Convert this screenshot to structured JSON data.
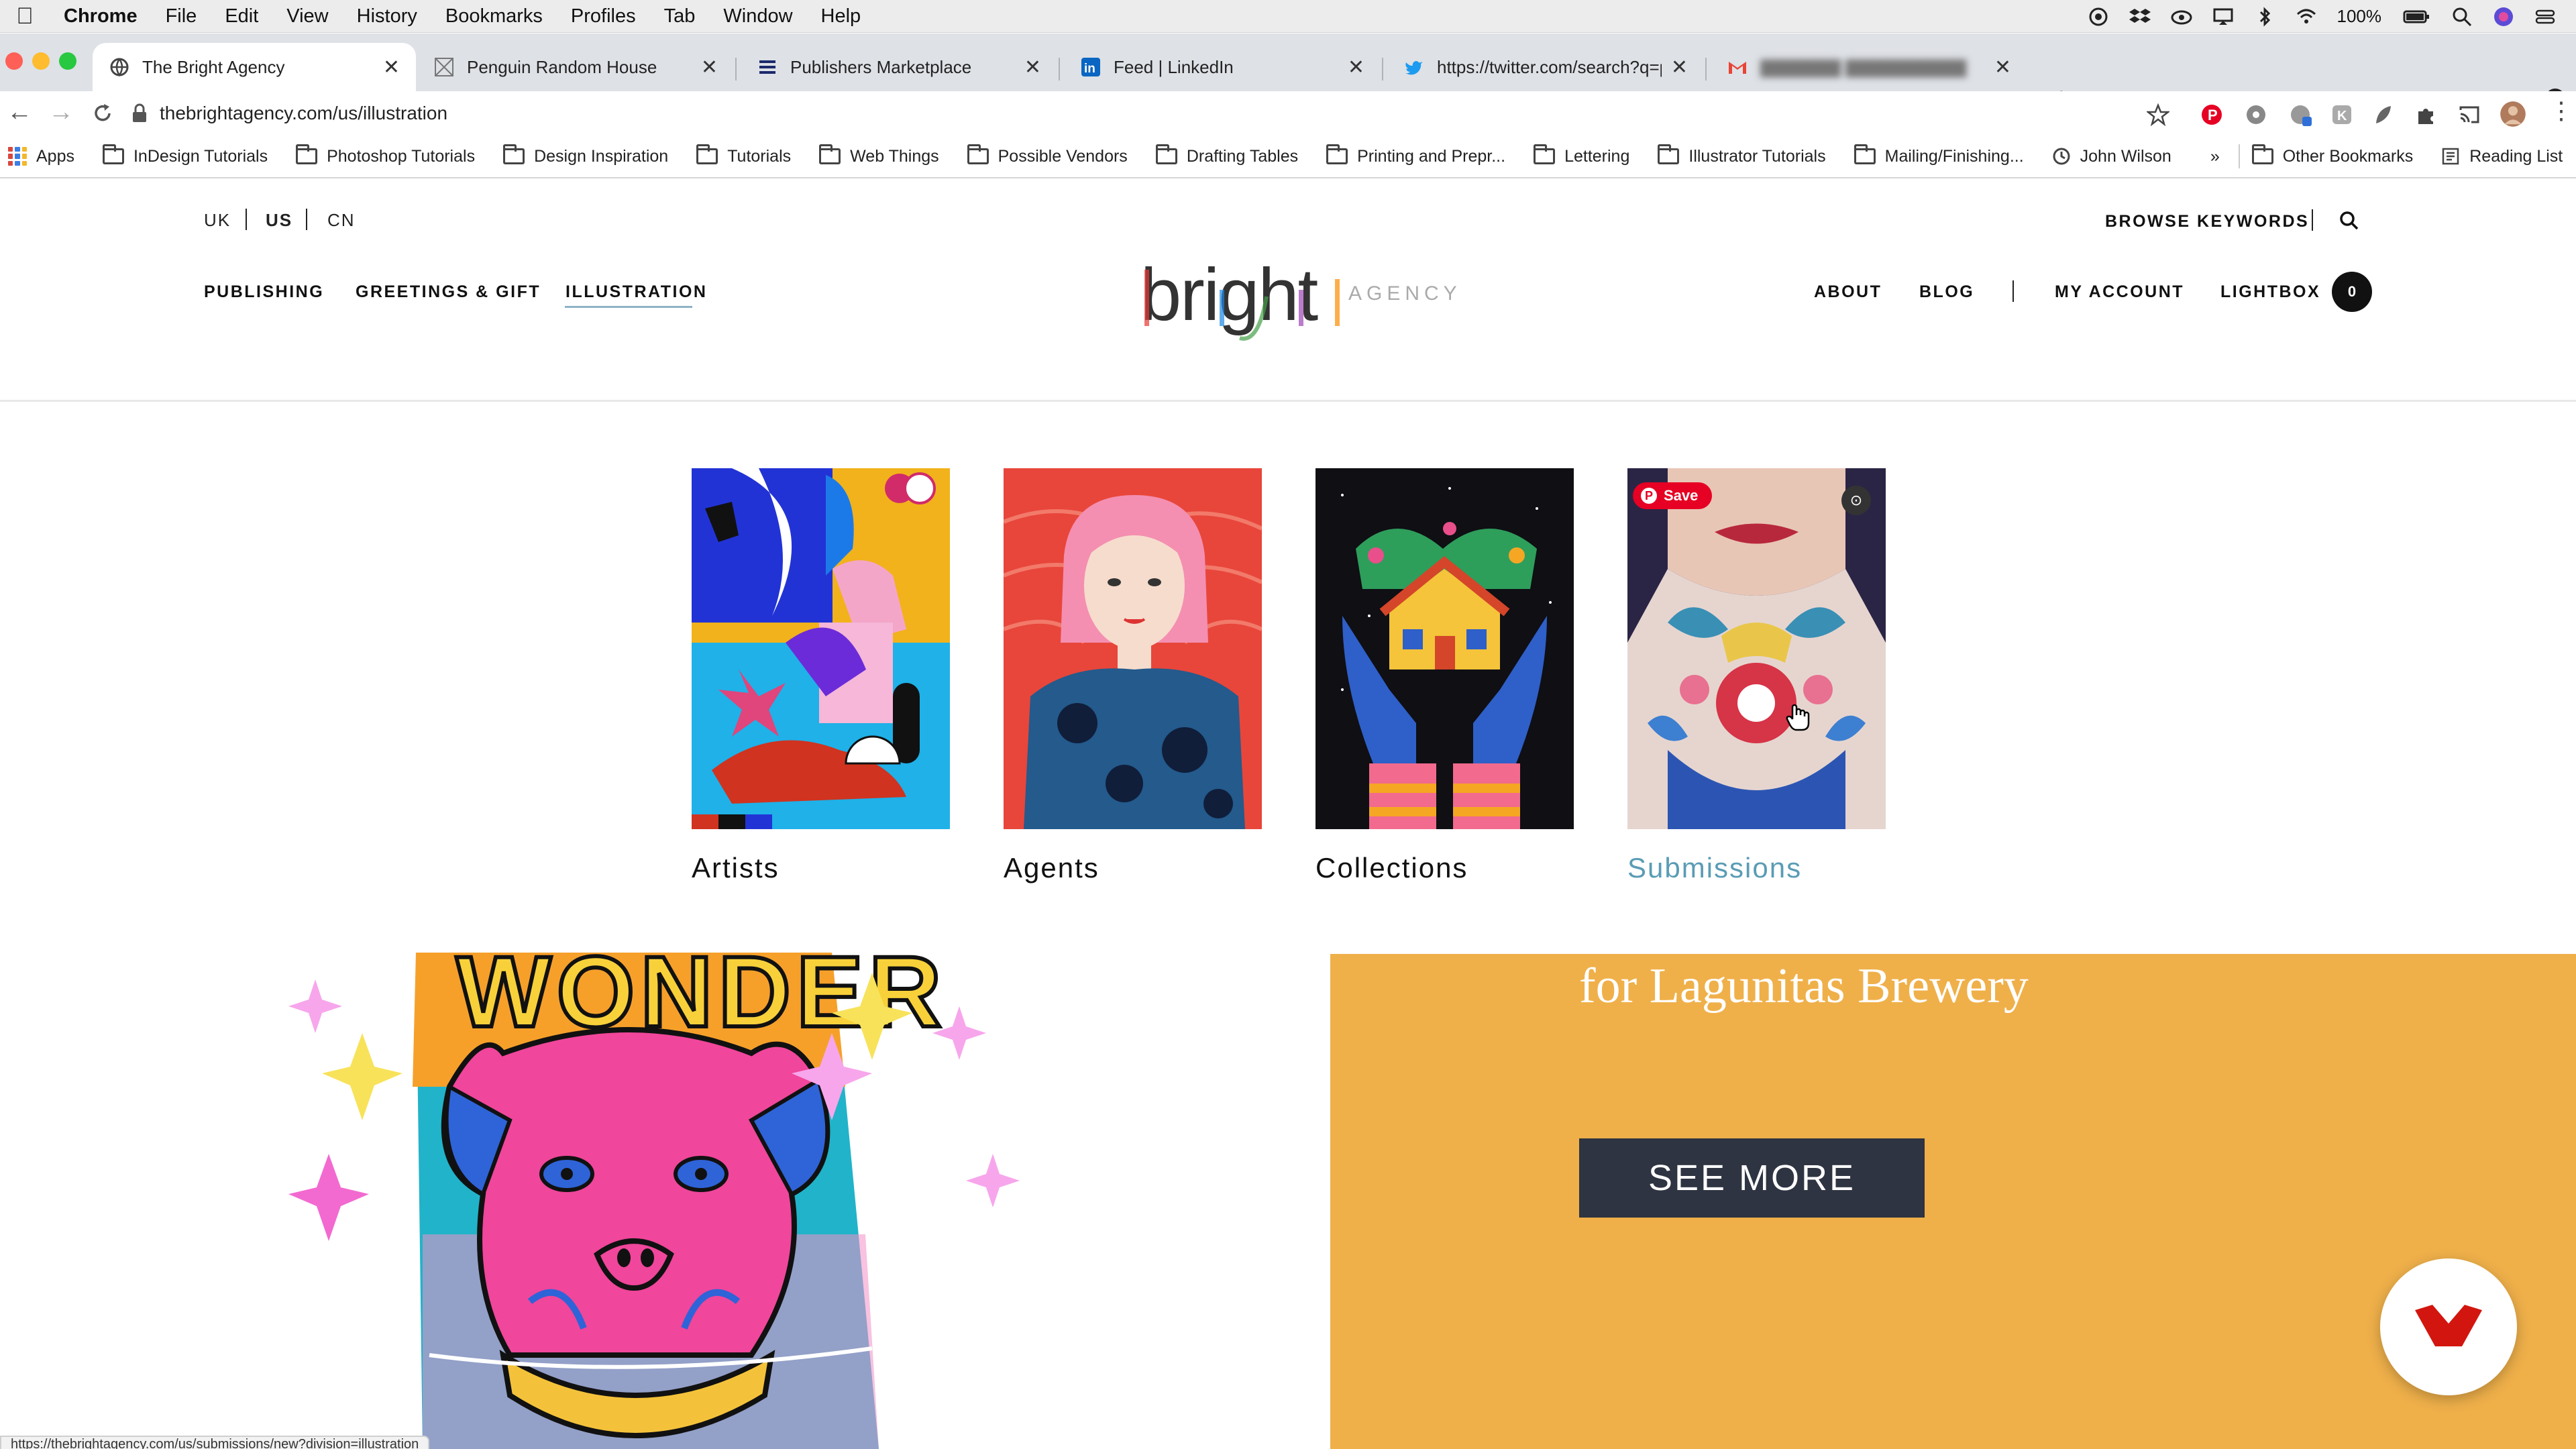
{
  "menubar": {
    "app": "Chrome",
    "items": [
      "File",
      "Edit",
      "View",
      "History",
      "Bookmarks",
      "Profiles",
      "Tab",
      "Window",
      "Help"
    ],
    "battery": "100%"
  },
  "tabs": [
    {
      "title": "The Bright Agency"
    },
    {
      "title": "Penguin Random House"
    },
    {
      "title": "Publishers Marketplace"
    },
    {
      "title": "Feed | LinkedIn"
    },
    {
      "title": "https://twitter.com/search?q=p"
    }
  ],
  "address_bar": {
    "url": "thebrightagency.com/us/illustration"
  },
  "bookmarks": {
    "apps": "Apps",
    "items": [
      "InDesign Tutorials",
      "Photoshop Tutorials",
      "Design Inspiration",
      "Tutorials",
      "Web Things",
      "Possible Vendors",
      "Drafting Tables",
      "Printing and Prepr...",
      "Lettering",
      "Illustrator Tutorials",
      "Mailing/Finishing..."
    ],
    "person": "John Wilson",
    "overflow": "»",
    "other": "Other Bookmarks",
    "reading_list": "Reading List"
  },
  "site": {
    "regions": [
      "UK",
      "US",
      "CN"
    ],
    "nav_left": [
      "PUBLISHING",
      "GREETINGS & GIFT",
      "ILLUSTRATION"
    ],
    "logo": "bright",
    "logo_sub": "AGENCY",
    "browse_keywords": "BROWSE KEYWORDS",
    "nav_right": [
      "ABOUT",
      "BLOG",
      "MY ACCOUNT",
      "LIGHTBOX"
    ],
    "lightbox_count": "0"
  },
  "categories": [
    {
      "label": "Artists"
    },
    {
      "label": "Agents"
    },
    {
      "label": "Collections"
    },
    {
      "label": "Submissions"
    }
  ],
  "pin_save": "Save",
  "hero": {
    "artwork_text": "WONDER",
    "promo_text": "for Lagunitas Brewery",
    "cta": "SEE MORE"
  },
  "status_url": "https://thebrightagency.com/us/submissions/new?division=illustration",
  "colors": {
    "accent_link": "#5a9cb5",
    "promo_bg": "#efb04a",
    "cta_bg": "#2e3441",
    "pinterest": "#e60023"
  }
}
